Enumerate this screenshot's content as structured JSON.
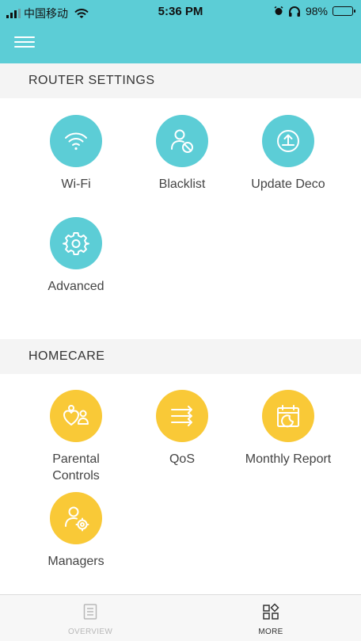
{
  "status_bar": {
    "carrier": "中国移动",
    "time": "5:36 PM",
    "battery": "98%",
    "battery_level": 0.98
  },
  "header": {
    "menu_icon": "hamburger-menu-icon",
    "bg_color": "#5ccdd6"
  },
  "sections": {
    "router_settings": {
      "title": "ROUTER SETTINGS",
      "items": [
        {
          "label": "Wi-Fi",
          "icon": "wifi-icon"
        },
        {
          "label": "Blacklist",
          "icon": "user-block-icon"
        },
        {
          "label": "Update Deco",
          "icon": "upload-icon"
        },
        {
          "label": "Advanced",
          "icon": "gear-icon"
        }
      ],
      "color": "#5ccdd6"
    },
    "homecare": {
      "title": "HOMECARE",
      "items": [
        {
          "label": "Parental Controls",
          "icon": "parental-controls-icon"
        },
        {
          "label": "QoS",
          "icon": "qos-arrows-icon"
        },
        {
          "label": "Monthly Report",
          "icon": "calendar-report-icon"
        },
        {
          "label": "Managers",
          "icon": "user-gear-icon"
        }
      ],
      "color": "#f9c937"
    }
  },
  "tab_bar": {
    "tabs": [
      {
        "label": "OVERVIEW",
        "icon": "document-icon",
        "active": false
      },
      {
        "label": "MORE",
        "icon": "grid-more-icon",
        "active": true
      }
    ]
  }
}
